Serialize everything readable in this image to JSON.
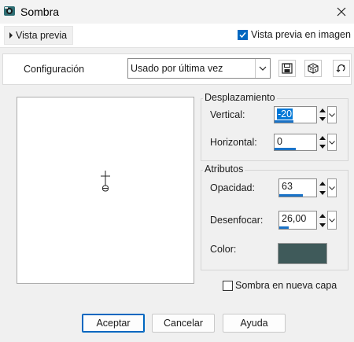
{
  "window": {
    "title": "Sombra"
  },
  "preview": {
    "toggle_label": "Vista previa",
    "checkbox_label": "Vista previa en imagen",
    "checkbox_checked": true
  },
  "config": {
    "label": "Configuración",
    "selected": "Usado por última vez"
  },
  "displacement": {
    "title": "Desplazamiento",
    "vertical": {
      "label": "Vertical:",
      "value": "-20",
      "fill": 0.45
    },
    "horizontal": {
      "label": "Horizontal:",
      "value": "0",
      "fill": 0.5
    }
  },
  "attributes": {
    "title": "Atributos",
    "opacity": {
      "label": "Opacidad:",
      "value": "63",
      "fill": 0.63
    },
    "blur": {
      "label": "Desenfocar:",
      "value": "26,00",
      "fill": 0.26
    },
    "color": {
      "label": "Color:",
      "value": "#3f5a5a"
    }
  },
  "new_layer": {
    "label": "Sombra en nueva capa",
    "checked": false
  },
  "buttons": {
    "ok": "Aceptar",
    "cancel": "Cancelar",
    "help": "Ayuda"
  }
}
